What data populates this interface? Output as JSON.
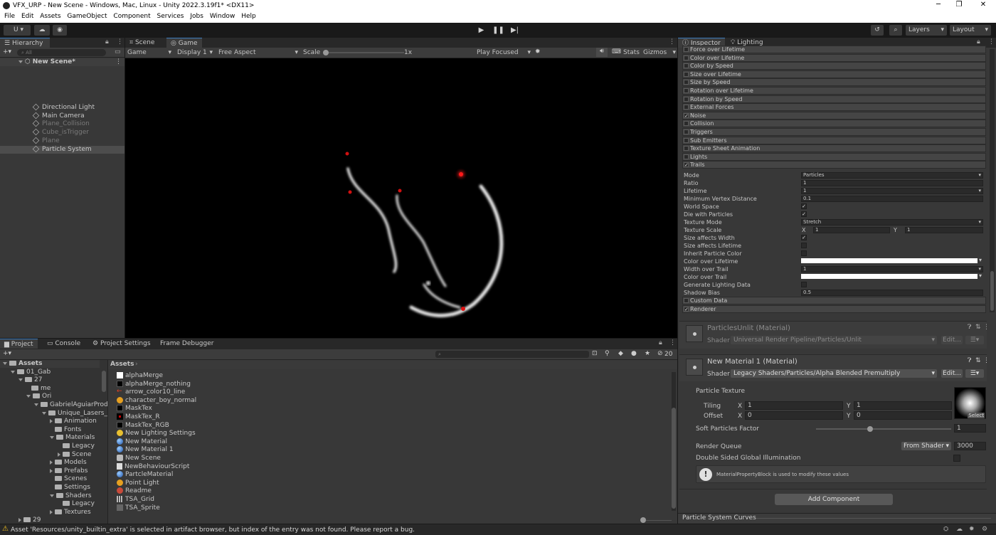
{
  "window": {
    "title": "VFX_URP - New Scene - Windows, Mac, Linux - Unity 2022.3.19f1* <DX11>",
    "minimize": "─",
    "maximize": "❐",
    "close": "✕"
  },
  "menu": [
    "File",
    "Edit",
    "Assets",
    "GameObject",
    "Component",
    "Services",
    "Jobs",
    "Window",
    "Help"
  ],
  "toolbar": {
    "account": "U ▾",
    "layers": "Layers",
    "layout": "Layout"
  },
  "hierarchy": {
    "tab": "Hierarchy",
    "search_placeholder": "All",
    "scene": "New Scene*",
    "items": [
      {
        "label": "Directional Light",
        "dim": false,
        "selected": false
      },
      {
        "label": "Main Camera",
        "dim": false,
        "selected": false
      },
      {
        "label": "Plane_Collision",
        "dim": true,
        "selected": false
      },
      {
        "label": "Cube_isTrigger",
        "dim": true,
        "selected": false
      },
      {
        "label": "Plane",
        "dim": true,
        "selected": false
      },
      {
        "label": "Particle System",
        "dim": false,
        "selected": true
      }
    ]
  },
  "scene_view": {
    "tabs": [
      "Scene",
      "Game"
    ],
    "game_dropdown": "Game",
    "display": "Display 1",
    "aspect": "Free Aspect",
    "scale_label": "Scale",
    "scale_value": "1x",
    "play_focused": "Play Focused",
    "stats": "Stats",
    "gizmos": "Gizmos"
  },
  "inspector": {
    "tabs": [
      "Inspector",
      "Lighting"
    ],
    "modules": [
      {
        "label": "Force over Lifetime",
        "checked": false
      },
      {
        "label": "Color over Lifetime",
        "checked": false
      },
      {
        "label": "Color by Speed",
        "checked": false
      },
      {
        "label": "Size over Lifetime",
        "checked": false
      },
      {
        "label": "Size by Speed",
        "checked": false
      },
      {
        "label": "Rotation over Lifetime",
        "checked": false
      },
      {
        "label": "Rotation by Speed",
        "checked": false
      },
      {
        "label": "External Forces",
        "checked": false
      },
      {
        "label": "Noise",
        "checked": true
      },
      {
        "label": "Collision",
        "checked": false
      },
      {
        "label": "Triggers",
        "checked": false
      },
      {
        "label": "Sub Emitters",
        "checked": false
      },
      {
        "label": "Texture Sheet Animation",
        "checked": false
      },
      {
        "label": "Lights",
        "checked": false
      },
      {
        "label": "Trails",
        "checked": true
      }
    ],
    "trails": {
      "mode_label": "Mode",
      "mode": "Particles",
      "ratio_label": "Ratio",
      "ratio": "1",
      "lifetime_label": "Lifetime",
      "lifetime": "1",
      "min_vertex_label": "Minimum Vertex Distance",
      "min_vertex": "0.1",
      "world_space_label": "World Space",
      "die_label": "Die with Particles",
      "tex_mode_label": "Texture Mode",
      "tex_mode": "Stretch",
      "tex_scale_label": "Texture Scale",
      "tex_scale_x": "1",
      "tex_scale_y": "1",
      "x": "X",
      "y": "Y",
      "size_width_label": "Size affects Width",
      "size_lifetime_label": "Size affects Lifetime",
      "inherit_label": "Inherit Particle Color",
      "color_lifetime_label": "Color over Lifetime",
      "width_trail_label": "Width over Trail",
      "width_trail": "1",
      "color_trail_label": "Color over Trail",
      "gen_light_label": "Generate Lighting Data",
      "shadow_label": "Shadow Bias",
      "shadow": "0.5"
    },
    "after_modules": [
      {
        "label": "Custom Data",
        "checked": false
      },
      {
        "label": "Renderer",
        "checked": true
      }
    ],
    "mat1": {
      "name": "ParticlesUnlit (Material)",
      "shader_label": "Shader",
      "shader": "Universal Render Pipeline/Particles/Unlit",
      "edit": "Edit..."
    },
    "mat2": {
      "name": "New Material 1 (Material)",
      "shader_label": "Shader",
      "shader": "Legacy Shaders/Particles/Alpha Blended Premultiply",
      "edit": "Edit...",
      "particle_texture": "Particle Texture",
      "tiling": "Tiling",
      "offset": "Offset",
      "tiling_x": "1",
      "tiling_y": "1",
      "offset_x": "0",
      "offset_y": "0",
      "select": "Select",
      "soft_label": "Soft Particles Factor",
      "soft": "1",
      "soft_fraction": 0.4,
      "render_queue": "Render Queue",
      "rq_mode": "From Shader",
      "rq_value": "3000",
      "double_sided": "Double Sided Global Illumination",
      "info": "MaterialPropertyBlock is used to modify these values"
    },
    "add_component": "Add Component",
    "curves": "Particle System Curves"
  },
  "project": {
    "tabs": [
      "Project",
      "Console",
      "Project Settings",
      "Frame Debugger"
    ],
    "hidden_count": "20",
    "tree": [
      {
        "label": "Assets",
        "depth": 0,
        "open": true,
        "bold": true
      },
      {
        "label": "01_Gab",
        "depth": 1,
        "open": true
      },
      {
        "label": "27",
        "depth": 2,
        "open": true
      },
      {
        "label": "me",
        "depth": 3,
        "open": null
      },
      {
        "label": "Ori",
        "depth": 3,
        "open": true
      },
      {
        "label": "GabrielAguiarProd",
        "depth": 4,
        "open": true
      },
      {
        "label": "Unique_Lasers_",
        "depth": 5,
        "open": true
      },
      {
        "label": "Animation",
        "depth": 6,
        "open": false
      },
      {
        "label": "Fonts",
        "depth": 6,
        "open": null
      },
      {
        "label": "Materials",
        "depth": 6,
        "open": true
      },
      {
        "label": "Legacy",
        "depth": 7,
        "open": null
      },
      {
        "label": "Scene",
        "depth": 7,
        "open": false
      },
      {
        "label": "Models",
        "depth": 6,
        "open": false
      },
      {
        "label": "Prefabs",
        "depth": 6,
        "open": false
      },
      {
        "label": "Scenes",
        "depth": 6,
        "open": null
      },
      {
        "label": "Settings",
        "depth": 6,
        "open": null
      },
      {
        "label": "Shaders",
        "depth": 6,
        "open": true
      },
      {
        "label": "Legacy",
        "depth": 7,
        "open": null
      },
      {
        "label": "Textures",
        "depth": 6,
        "open": false
      },
      {
        "label": "29",
        "depth": 2,
        "open": false
      }
    ],
    "breadcrumb": "Assets",
    "assets": [
      {
        "label": "alphaMerge",
        "icon": "white-square-icon"
      },
      {
        "label": "alphaMerge_nothing",
        "icon": "dot-icon"
      },
      {
        "label": "arrow_color10_line",
        "icon": "arrow-icon"
      },
      {
        "label": "character_boy_normal",
        "icon": "prefab-icon"
      },
      {
        "label": "MaskTex",
        "icon": "dot-icon"
      },
      {
        "label": "MaskTex_R",
        "icon": "red-dot-icon"
      },
      {
        "label": "MaskTex_RGB",
        "icon": "dot-icon"
      },
      {
        "label": "New Lighting Settings",
        "icon": "lighting-icon"
      },
      {
        "label": "New Material",
        "icon": "material-icon"
      },
      {
        "label": "New Material 1",
        "icon": "material-icon"
      },
      {
        "label": "New Scene",
        "icon": "scene-icon"
      },
      {
        "label": "NewBehaviourScript",
        "icon": "script-icon"
      },
      {
        "label": "PartcleMaterial",
        "icon": "material-icon"
      },
      {
        "label": "Point Light",
        "icon": "prefab-icon"
      },
      {
        "label": "Readme",
        "icon": "readme-icon"
      },
      {
        "label": "TSA_Grid",
        "icon": "grid-icon"
      },
      {
        "label": "TSA_Sprite",
        "icon": "sprite-icon"
      }
    ]
  },
  "status": {
    "message": "Asset 'Resources/unity_builtin_extra' is selected in artifact browser, but index of the entry was not found. Please report a bug."
  }
}
